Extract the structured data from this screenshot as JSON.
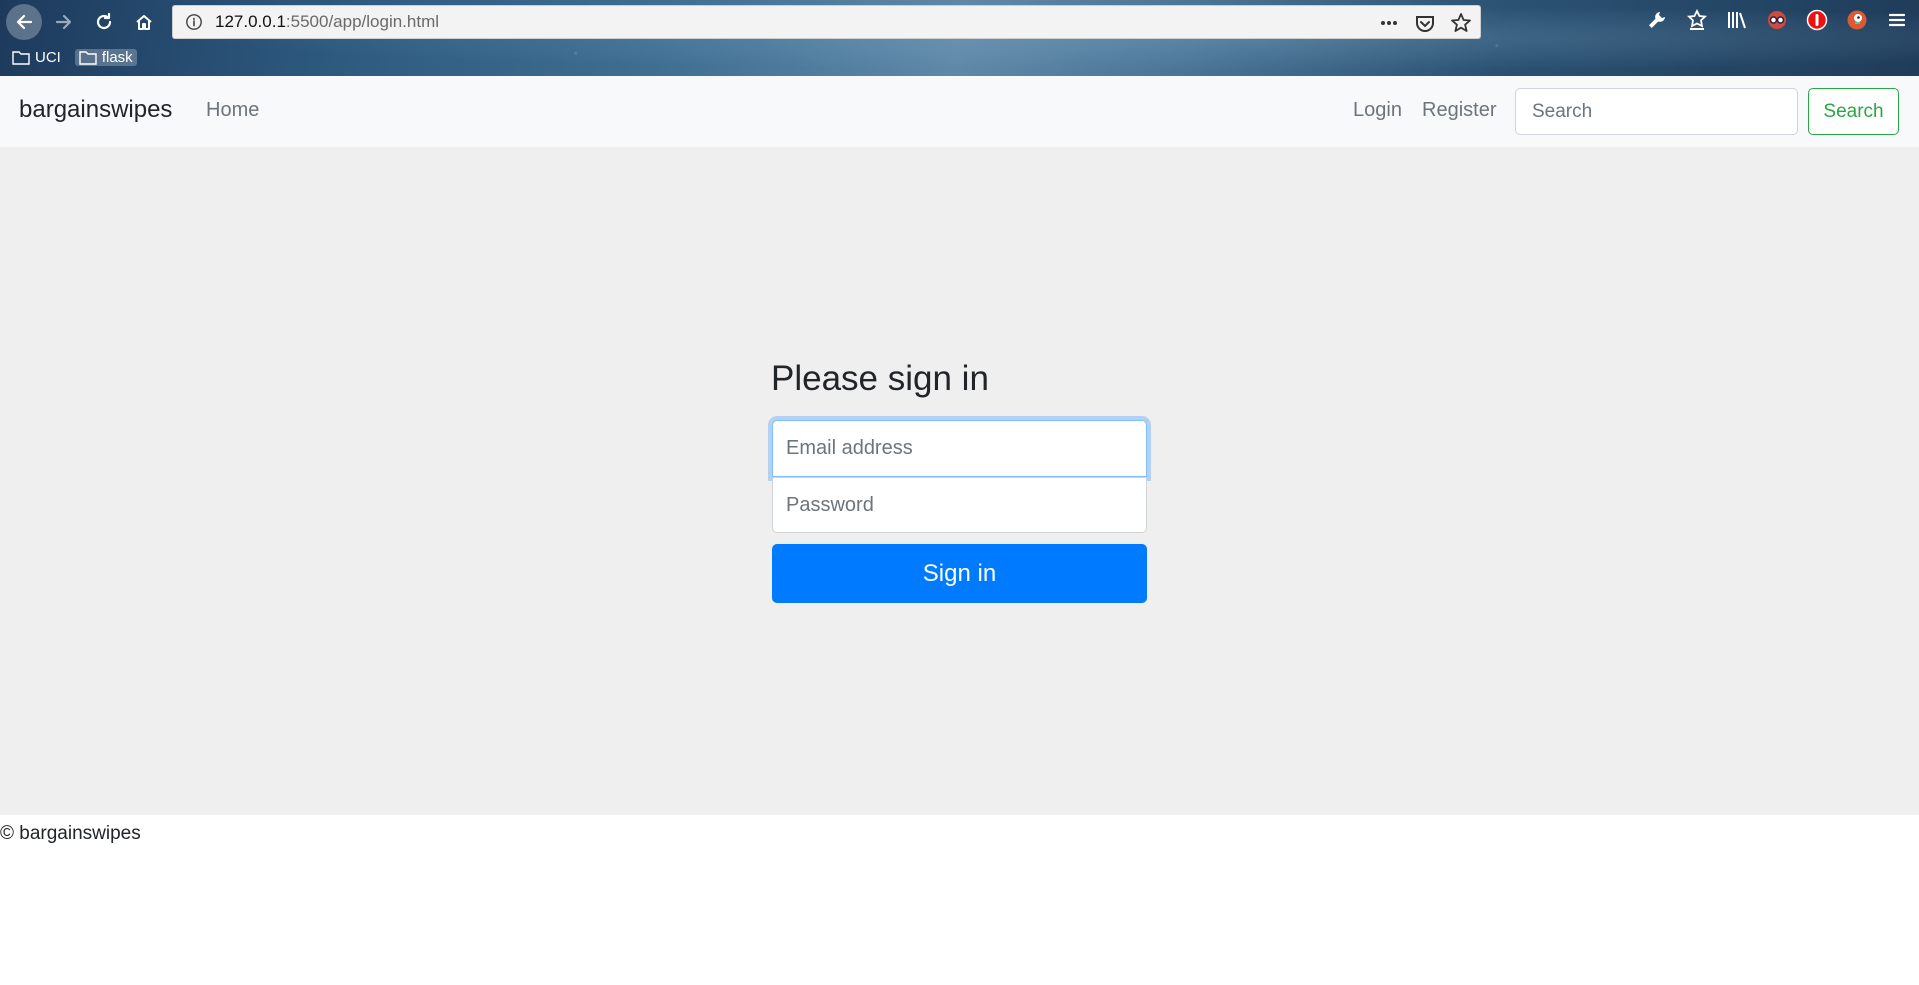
{
  "browser": {
    "url_host": "127.0.0.1",
    "url_rest": ":5500/app/login.html",
    "bookmarks": [
      "UCI",
      "flask"
    ]
  },
  "navbar": {
    "brand": "bargainswipes",
    "home": "Home",
    "login": "Login",
    "register": "Register",
    "search_placeholder": "Search",
    "search_button": "Search"
  },
  "form": {
    "title": "Please sign in",
    "email_placeholder": "Email address",
    "password_placeholder": "Password",
    "submit": "Sign in"
  },
  "footer": {
    "text": "© bargainswipes"
  },
  "colors": {
    "primary": "#007bff",
    "success": "#28a745",
    "navbar_bg": "#f8f9fa",
    "main_bg": "#efefef"
  },
  "icons": [
    "back-arrow-icon",
    "forward-arrow-icon",
    "reload-icon",
    "home-icon",
    "info-icon",
    "more-dots-icon",
    "pocket-icon",
    "star-icon",
    "wrench-icon",
    "reading-list-icon",
    "library-icon",
    "extension-icons",
    "menu-icon",
    "folder-icon"
  ]
}
